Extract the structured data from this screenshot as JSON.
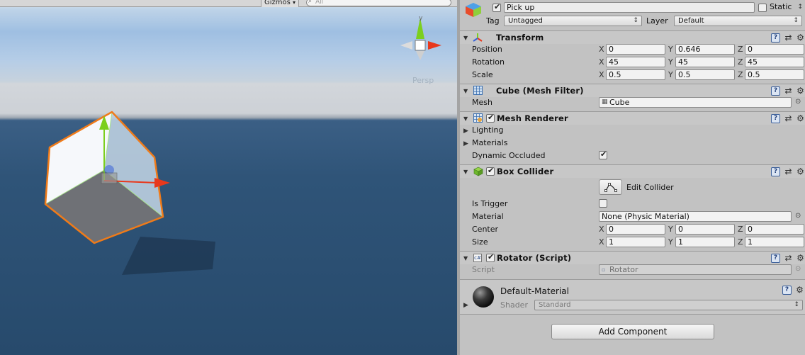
{
  "scene": {
    "gizmos_label": "Gizmos",
    "search_placeholder": "All",
    "persp_label": "Persp",
    "axis_y": "y"
  },
  "gameobject": {
    "name": "Pick up",
    "static_label": "Static",
    "static_checked": false,
    "active_checked": true,
    "tag_label": "Tag",
    "tag_value": "Untagged",
    "layer_label": "Layer",
    "layer_value": "Default"
  },
  "transform": {
    "title": "Transform",
    "position_label": "Position",
    "rotation_label": "Rotation",
    "scale_label": "Scale",
    "x": "X",
    "y": "Y",
    "z": "Z",
    "position": {
      "x": "0",
      "y": "0.646",
      "z": "0"
    },
    "rotation": {
      "x": "45",
      "y": "45",
      "z": "45"
    },
    "scale": {
      "x": "0.5",
      "y": "0.5",
      "z": "0.5"
    }
  },
  "mesh_filter": {
    "title": "Cube (Mesh Filter)",
    "mesh_label": "Mesh",
    "mesh_value": "Cube"
  },
  "mesh_renderer": {
    "title": "Mesh Renderer",
    "enabled": true,
    "lighting_label": "Lighting",
    "materials_label": "Materials",
    "dynamic_occluded_label": "Dynamic Occluded",
    "dynamic_occluded_checked": true
  },
  "box_collider": {
    "title": "Box Collider",
    "enabled": true,
    "edit_collider_label": "Edit Collider",
    "is_trigger_label": "Is Trigger",
    "is_trigger_checked": false,
    "material_label": "Material",
    "material_value": "None (Physic Material)",
    "center_label": "Center",
    "size_label": "Size",
    "center": {
      "x": "0",
      "y": "0",
      "z": "0"
    },
    "size": {
      "x": "1",
      "y": "1",
      "z": "1"
    }
  },
  "rotator": {
    "title": "Rotator (Script)",
    "enabled": true,
    "script_label": "Script",
    "script_value": "Rotator",
    "script_icon_text": "c#"
  },
  "material": {
    "name": "Default-Material",
    "shader_label": "Shader",
    "shader_value": "Standard"
  },
  "add_component_label": "Add Component",
  "colors": {
    "selection_outline": "#f07b19",
    "gizmo_y": "#7ccf1e",
    "gizmo_x": "#e8381c",
    "gizmo_z": "#3a63d8",
    "sea": "#2f5478"
  }
}
